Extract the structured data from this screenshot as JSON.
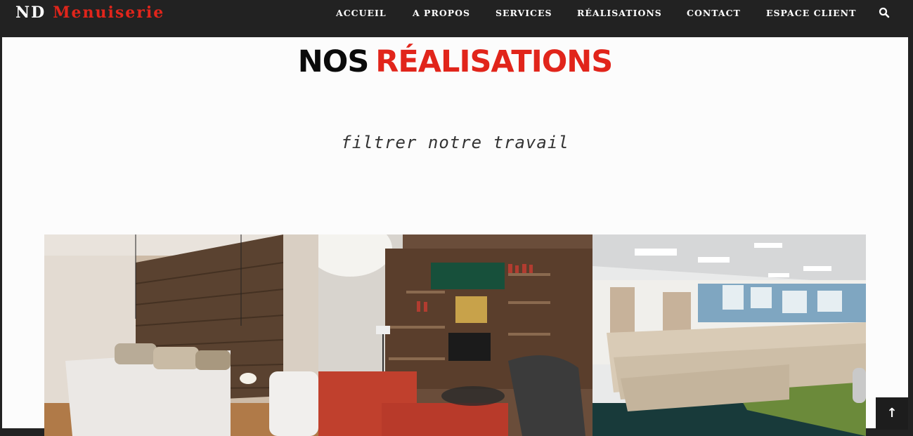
{
  "brand": {
    "part1": "ND",
    "part2": "Menuiserie"
  },
  "nav": [
    {
      "label": "ACCUEIL"
    },
    {
      "label": "A PROPOS"
    },
    {
      "label": "SERVICES"
    },
    {
      "label": "RÉALISATIONS"
    },
    {
      "label": "CONTACT"
    },
    {
      "label": "ESPACE CLIENT"
    }
  ],
  "search": {
    "icon": "search-icon"
  },
  "page": {
    "title_part1": "NOS",
    "title_part2": "RÉALISATIONS",
    "filter_label": "filtrer notre travail"
  },
  "gallery": [
    {
      "subject": "bedroom with reclaimed wood wall"
    },
    {
      "subject": "living room with wooden bookcase wall unit"
    },
    {
      "subject": "auditorium with light wood tiered seating"
    }
  ],
  "scroll_top": {
    "icon": "arrow-up-icon",
    "glyph": "↑"
  },
  "colors": {
    "accent": "#e1251b",
    "dark": "#222222",
    "background": "#fcfcfc"
  }
}
